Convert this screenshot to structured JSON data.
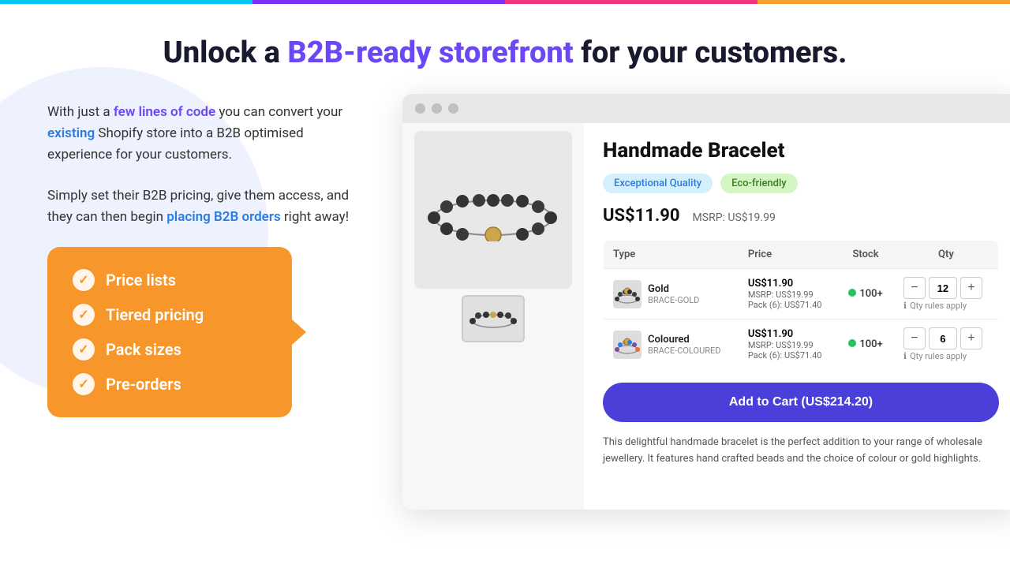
{
  "topbar": {
    "segments": [
      "cyan",
      "purple",
      "pink",
      "orange"
    ]
  },
  "hero": {
    "prefix": "Unlock a ",
    "highlight": "B2B-ready storefront",
    "suffix": " for your customers."
  },
  "left": {
    "para1_prefix": "With just a ",
    "para1_link1": "few lines of code",
    "para1_mid": " you can convert your ",
    "para1_link2": "existing",
    "para1_suffix": " Shopify store into a B2B optimised experience for your customers.",
    "para2_prefix": "Simply set their B2B pricing, give them access, and they can then begin ",
    "para2_link": "placing B2B orders",
    "para2_suffix": " right away!"
  },
  "features": {
    "items": [
      "Price lists",
      "Tiered pricing",
      "Pack sizes",
      "Pre-orders"
    ]
  },
  "browser": {
    "dots": [
      "gray",
      "gray",
      "gray"
    ]
  },
  "product": {
    "title": "Handmade Bracelet",
    "badges": [
      {
        "label": "Exceptional Quality",
        "type": "quality"
      },
      {
        "label": "Eco-friendly",
        "type": "eco"
      }
    ],
    "price": "US$11.90",
    "msrp": "MSRP: US$19.99",
    "table": {
      "headers": [
        "Type",
        "Price",
        "Stock",
        "Qty"
      ],
      "rows": [
        {
          "name": "Gold",
          "sku": "BRACE-GOLD",
          "price_main": "US$11.90",
          "price_msrp": "MSRP: US$19.99",
          "price_pack": "Pack (6): US$71.40",
          "stock_label": "100+",
          "qty": "12"
        },
        {
          "name": "Coloured",
          "sku": "BRACE-COLOURED",
          "price_main": "US$11.90",
          "price_msrp": "MSRP: US$19.99",
          "price_pack": "Pack (6): US$71.40",
          "stock_label": "100+",
          "qty": "6"
        }
      ],
      "qty_rules": "Qty rules apply"
    },
    "add_cart_label": "Add to Cart (US$214.20)",
    "description": "This delightful handmade bracelet is the perfect addition to your range of wholesale jewellery. It features hand crafted beads and the choice of colour or gold highlights."
  }
}
